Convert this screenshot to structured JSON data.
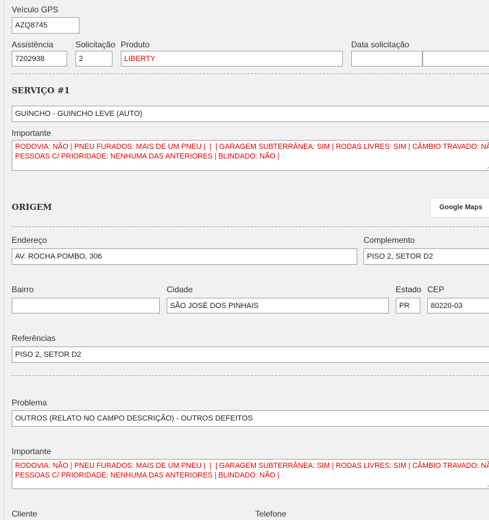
{
  "vehicle": {
    "label": "Veículo GPS",
    "value": "AZQ8745"
  },
  "request": {
    "assistencia": {
      "label": "Assistência",
      "value": "7202938"
    },
    "solicitacao": {
      "label": "Solicitação",
      "value": "2"
    },
    "produto": {
      "label": "Produto",
      "value": "LIBERTY"
    },
    "data": {
      "label": "Data solicitação",
      "date": "",
      "time": ""
    }
  },
  "service": {
    "title": "SERVIÇO #1",
    "value": "GUINCHO - GUINCHO LEVE (AUTO)",
    "important_label": "Importante",
    "important_line1": "RODOVIA: NÃO | PNEU FURADOS: MAIS DE UM PNEU |  |  | GARAGEM SUBTERRÂNEA: SIM | RODAS LIVRES: SIM | CÂMBIO TRAVADO: NÃO |",
    "important_line2": "PESSOAS C/ PRIORIDADE: NENHUMA DAS ANTERIORES | BLINDADO: NÃO |"
  },
  "origin": {
    "title": "ORIGEM",
    "maps_button": "Google Maps",
    "endereco": {
      "label": "Endereço",
      "value": "AV. ROCHA POMBO, 306"
    },
    "complemento": {
      "label": "Complemento",
      "value": "PISO 2, SETOR D2"
    },
    "bairro": {
      "label": "Bairro",
      "value": ""
    },
    "cidade": {
      "label": "Cidade",
      "value": "SÃO JOSÉ DOS PINHAIS"
    },
    "estado": {
      "label": "Estado",
      "value": "PR"
    },
    "cep": {
      "label": "CEP",
      "value": "80220-03"
    },
    "referencias": {
      "label": "Referências",
      "value": "PISO 2, SETOR D2"
    }
  },
  "problem": {
    "label": "Problema",
    "value": "OUTROS (RELATO NO CAMPO DESCRIÇÃO) - OUTROS DEFEITOS",
    "important_label": "Importante",
    "important_line1": "RODOVIA: NÃO | PNEU FURADOS: MAIS DE UM PNEU |  |  | GARAGEM SUBTERRÂNEA: SIM | RODAS LIVRES: SIM | CÂMBIO TRAVADO: NÃO |",
    "important_line2": "PESSOAS C/ PRIORIDADE: NENHUMA DAS ANTERIORES | BLINDADO: NÃO |"
  },
  "client": {
    "cliente_label": "Cliente",
    "telefone_label": "Telefone"
  }
}
